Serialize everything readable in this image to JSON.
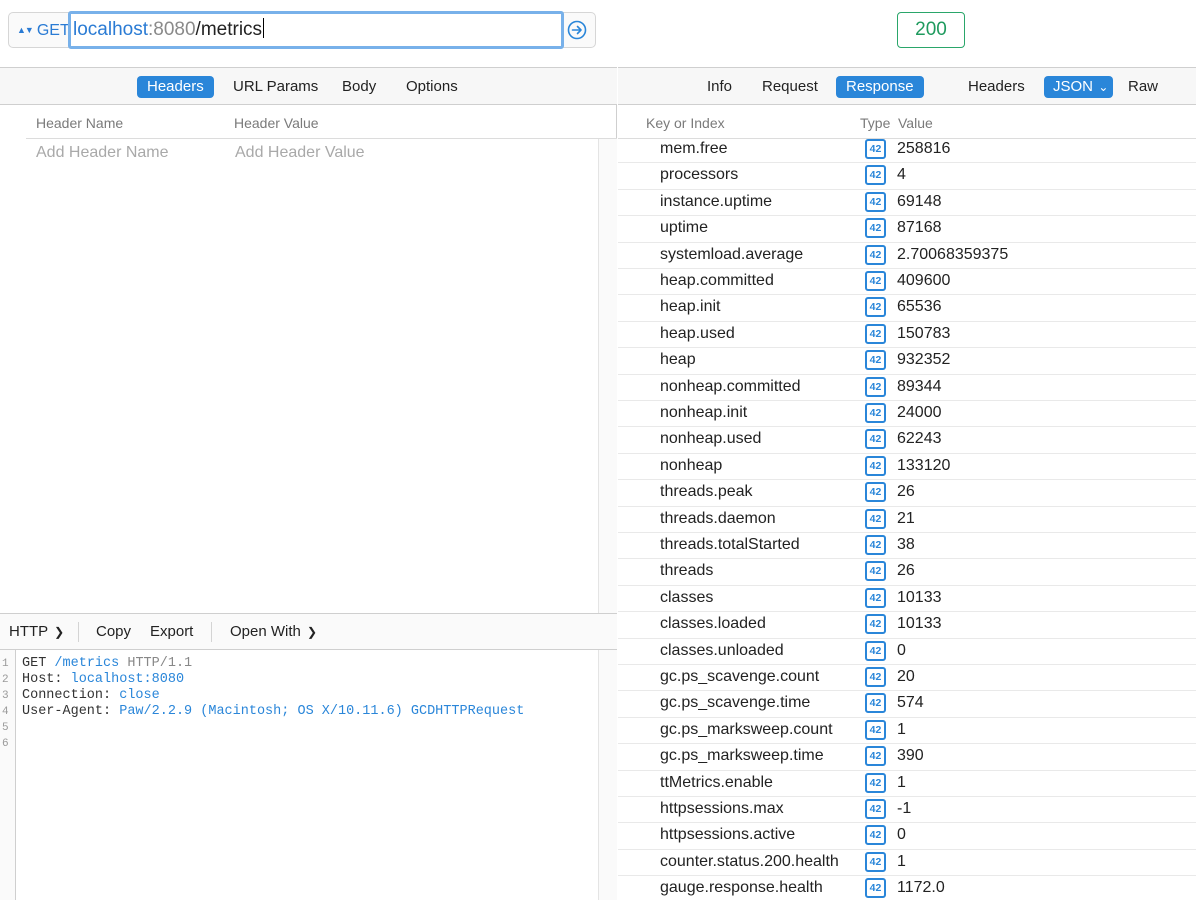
{
  "request": {
    "method": "GET",
    "url_host": "localhost",
    "url_port": ":8080",
    "url_path": "/metrics"
  },
  "request_tabs": [
    "Headers",
    "URL Params",
    "Body",
    "Options"
  ],
  "headers_table": {
    "col_name": "Header Name",
    "col_value": "Header Value",
    "placeholder_name": "Add Header Name",
    "placeholder_value": "Add Header Value"
  },
  "code_toolbar": {
    "format": "HTTP",
    "copy": "Copy",
    "export": "Export",
    "open_with": "Open With"
  },
  "code": {
    "line_numbers": [
      "1",
      "2",
      "3",
      "4",
      "5",
      "6"
    ],
    "l1_method": "GET",
    "l1_path": "/metrics",
    "l1_proto": "HTTP/1.1",
    "l2_key": "Host:",
    "l2_val": "localhost:8080",
    "l3_key": "Connection:",
    "l3_val": "close",
    "l4_key": "User-Agent:",
    "l4_val": "Paw/2.2.9 (Macintosh; OS X/10.11.6) GCDHTTPRequest"
  },
  "response": {
    "status": "200",
    "tabs": [
      "Info",
      "Request",
      "Response"
    ],
    "view_tabs": [
      "Headers",
      "JSON",
      "Raw"
    ],
    "col_key": "Key or Index",
    "col_type": "Type",
    "col_value": "Value",
    "type_badge": "42",
    "rows": [
      {
        "key": "mem.free",
        "value": "258816"
      },
      {
        "key": "processors",
        "value": "4"
      },
      {
        "key": "instance.uptime",
        "value": "69148"
      },
      {
        "key": "uptime",
        "value": "87168"
      },
      {
        "key": "systemload.average",
        "value": "2.70068359375"
      },
      {
        "key": "heap.committed",
        "value": "409600"
      },
      {
        "key": "heap.init",
        "value": "65536"
      },
      {
        "key": "heap.used",
        "value": "150783"
      },
      {
        "key": "heap",
        "value": "932352"
      },
      {
        "key": "nonheap.committed",
        "value": "89344"
      },
      {
        "key": "nonheap.init",
        "value": "24000"
      },
      {
        "key": "nonheap.used",
        "value": "62243"
      },
      {
        "key": "nonheap",
        "value": "133120"
      },
      {
        "key": "threads.peak",
        "value": "26"
      },
      {
        "key": "threads.daemon",
        "value": "21"
      },
      {
        "key": "threads.totalStarted",
        "value": "38"
      },
      {
        "key": "threads",
        "value": "26"
      },
      {
        "key": "classes",
        "value": "10133"
      },
      {
        "key": "classes.loaded",
        "value": "10133"
      },
      {
        "key": "classes.unloaded",
        "value": "0"
      },
      {
        "key": "gc.ps_scavenge.count",
        "value": "20"
      },
      {
        "key": "gc.ps_scavenge.time",
        "value": "574"
      },
      {
        "key": "gc.ps_marksweep.count",
        "value": "1"
      },
      {
        "key": "gc.ps_marksweep.time",
        "value": "390"
      },
      {
        "key": "ttMetrics.enable",
        "value": "1"
      },
      {
        "key": "httpsessions.max",
        "value": "-1"
      },
      {
        "key": "httpsessions.active",
        "value": "0"
      },
      {
        "key": "counter.status.200.health",
        "value": "1"
      },
      {
        "key": "gauge.response.health",
        "value": "1172.0"
      }
    ]
  },
  "colors": {
    "accent": "#2a86d9",
    "status_ok": "#1f9a5e"
  }
}
